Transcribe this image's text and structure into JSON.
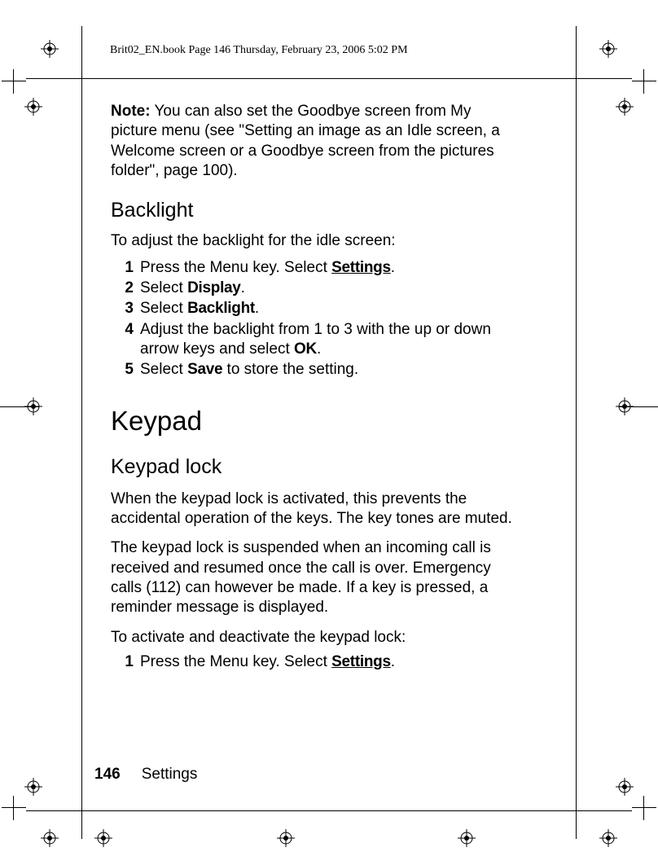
{
  "header": {
    "running_head": "Brit02_EN.book  Page 146  Thursday, February 23, 2006  5:02 PM"
  },
  "note": {
    "label": "Note:",
    "text": " You can also set the Goodbye screen from My picture menu (see \"Setting an image as an Idle screen, a Welcome screen or a Goodbye screen from the pictures folder\", page 100)."
  },
  "backlight": {
    "heading": "Backlight",
    "intro": "To adjust the backlight for the idle screen:",
    "steps": {
      "s1a": "Press the Menu key. Select ",
      "s1b": "Settings",
      "s1c": ".",
      "s2a": "Select ",
      "s2b": "Display",
      "s2c": ".",
      "s3a": "Select ",
      "s3b": "Backlight",
      "s3c": ".",
      "s4a": "Adjust the backlight from 1 to 3 with the up or down arrow keys and select ",
      "s4b": "OK",
      "s4c": ".",
      "s5a": "Select ",
      "s5b": "Save",
      "s5c": " to store the setting."
    }
  },
  "keypad": {
    "heading": "Keypad",
    "lock_heading": "Keypad lock",
    "p1": "When the keypad lock is activated, this prevents the accidental operation of the keys. The key tones are muted.",
    "p2": "The keypad lock is suspended when an incoming call is received and resumed once the call is over. Emergency calls (112) can however be made. If a key is pressed, a reminder message is displayed.",
    "p3": "To activate and deactivate the keypad lock:",
    "steps": {
      "s1a": "Press the Menu key. Select ",
      "s1b": "Settings",
      "s1c": "."
    }
  },
  "footer": {
    "page_number": "146",
    "section": "Settings"
  },
  "nums": {
    "n1": "1",
    "n2": "2",
    "n3": "3",
    "n4": "4",
    "n5": "5"
  }
}
